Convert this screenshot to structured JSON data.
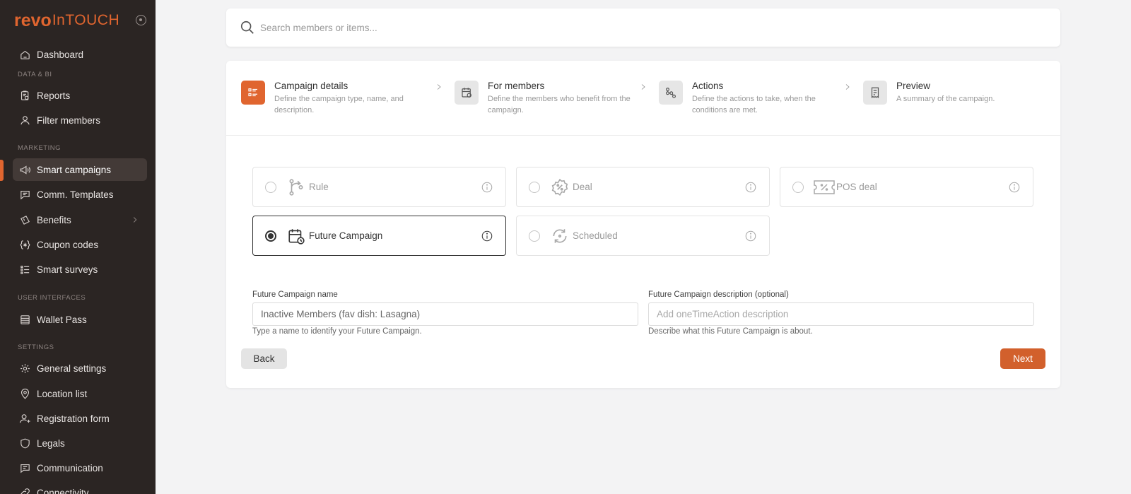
{
  "brand": {
    "revo": "revo",
    "intouch": "InTOUCH"
  },
  "sidebar": {
    "sections": {
      "data_bi": "DATA & BI",
      "marketing": "MARKETING",
      "user_interfaces": "USER INTERFACES",
      "settings": "SETTINGS"
    },
    "items": {
      "dashboard": "Dashboard",
      "reports": "Reports",
      "filter_members": "Filter members",
      "smart_campaigns": "Smart campaigns",
      "comm_templates": "Comm. Templates",
      "benefits": "Benefits",
      "coupon_codes": "Coupon codes",
      "smart_surveys": "Smart surveys",
      "wallet_pass": "Wallet Pass",
      "general_settings": "General settings",
      "location_list": "Location list",
      "registration_form": "Registration form",
      "legals": "Legals",
      "communication": "Communication",
      "connectivity": "Connectivity"
    },
    "active": "Smart campaigns"
  },
  "search": {
    "placeholder": "Search members or items..."
  },
  "steps": [
    {
      "title": "Campaign details",
      "desc": "Define the campaign type, name, and description."
    },
    {
      "title": "For members",
      "desc": "Define the members who benefit from the campaign."
    },
    {
      "title": "Actions",
      "desc": "Define the actions to take, when the conditions are met."
    },
    {
      "title": "Preview",
      "desc": "A summary of the campaign."
    }
  ],
  "options": {
    "rule": "Rule",
    "deal": "Deal",
    "pos_deal": "POS deal",
    "future_campaign": "Future Campaign",
    "scheduled": "Scheduled",
    "selected": "Future Campaign"
  },
  "form": {
    "name_label": "Future Campaign name",
    "name_value": "Inactive Members (fav dish: Lasagna)",
    "name_help": "Type a name to identify your Future Campaign.",
    "desc_label": "Future Campaign description (optional)",
    "desc_placeholder": "Add oneTimeAction description",
    "desc_help": "Describe what this Future Campaign is about."
  },
  "buttons": {
    "back": "Back",
    "next": "Next"
  },
  "colors": {
    "accent": "#e0652f",
    "sidebar_bg": "#2b2523",
    "next_button": "#d2602c"
  }
}
